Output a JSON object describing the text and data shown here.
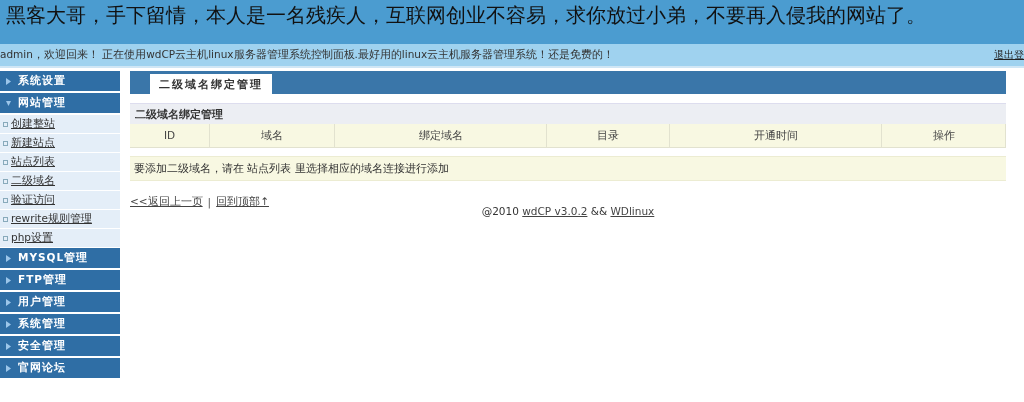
{
  "banner": {
    "text": "黑客大哥，手下留情，本人是一名残疾人，互联网创业不容易，求你放过小弟，不要再入侵我的网站了。"
  },
  "info_bar": {
    "text": "admin，欢迎回来！ 正在使用wdCP云主机linux服务器管理系统控制面板.最好用的linux云主机服务器管理系统！还是免费的！",
    "logout": "退出登"
  },
  "sidebar": {
    "sections": [
      {
        "label": "系统设置",
        "expanded": false
      },
      {
        "label": "网站管理",
        "expanded": true,
        "items": [
          "创建整站",
          "新建站点",
          "站点列表",
          "二级域名",
          "验证访问",
          "rewrite规则管理",
          "php设置"
        ]
      },
      {
        "label": "MYSQL管理",
        "expanded": false
      },
      {
        "label": "FTP管理",
        "expanded": false
      },
      {
        "label": "用户管理",
        "expanded": false
      },
      {
        "label": "系统管理",
        "expanded": false
      },
      {
        "label": "安全管理",
        "expanded": false
      },
      {
        "label": "官网论坛",
        "expanded": false
      }
    ]
  },
  "tabs": [
    {
      "label": "二级域名绑定管理",
      "selected": true
    }
  ],
  "table": {
    "title": "二级域名绑定管理",
    "columns": [
      "ID",
      "域名",
      "绑定域名",
      "目录",
      "开通时间",
      "操作"
    ]
  },
  "notice": "要添加二级域名，请在 站点列表 里选择相应的域名连接进行添加",
  "nav_links": [
    "<<返回上一页",
    "回到顶部↑"
  ],
  "nav_separator": "|",
  "footer": {
    "prefix": "@2010",
    "link1": "wdCP v3.0.2",
    "middle": "&&",
    "link2": "WDlinux"
  }
}
